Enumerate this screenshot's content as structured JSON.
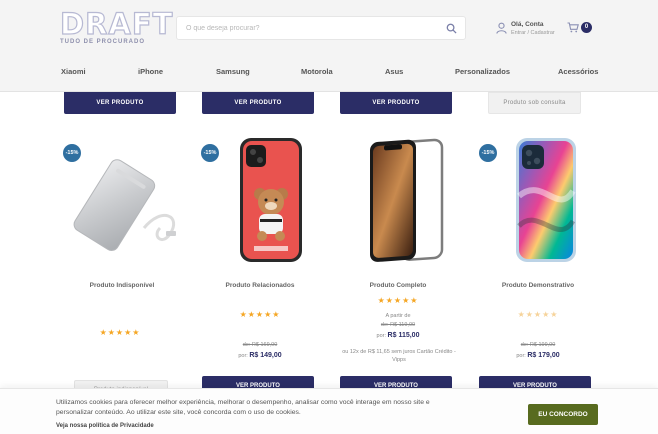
{
  "header": {
    "logo_text": "DRAFT",
    "logo_tagline": "TUDO DE PROCURADO",
    "search_placeholder": "O que deseja procurar?",
    "account_greeting": "Olá, Conta",
    "account_links": "Entrar / Cadastrar",
    "cart_count": "0"
  },
  "nav": {
    "items": [
      "Xiaomi",
      "iPhone",
      "Samsung",
      "Motorola",
      "Asus",
      "Personalizados",
      "Acessórios"
    ]
  },
  "top_row_buttons": [
    "VER PRODUTO",
    "VER PRODUTO",
    "VER PRODUTO",
    "Produto sob consulta"
  ],
  "products": [
    {
      "discount": "-15%",
      "name": "Produto Indisponível",
      "rating": 5,
      "button_label": "Produto indisponível"
    },
    {
      "discount": "-15%",
      "name": "Produto Relacionados",
      "rating": 5,
      "price_old_label": "de: R$ 169,00",
      "price_label_prefix": "por:",
      "price_new": "R$ 149,00",
      "button_label": "VER PRODUTO"
    },
    {
      "name": "Produto Completo",
      "rating": 5,
      "price_from_label": "A partir de",
      "price_old_label": "de: R$ 119,00",
      "price_label_prefix": "por:",
      "price_new": "R$ 115,00",
      "installment_label": "ou 12x de R$ 11,65 sem juros Cartão Crédito - Vipps",
      "button_label": "VER PRODUTO"
    },
    {
      "discount": "-15%",
      "name": "Produto Demonstrativo",
      "rating": 0,
      "price_old_label": "de: R$ 199,00",
      "price_label_prefix": "por:",
      "price_new": "R$ 179,00",
      "button_label": "VER PRODUTO"
    }
  ],
  "cookie": {
    "text": "Utilizamos cookies para oferecer melhor experiência, melhorar o desempenho, analisar como você interage em nosso site e personalizar conteúdo. Ao utilizar este site, você concorda com o uso de cookies.",
    "policy_link": "Veja nossa política de Privacidade",
    "accept_label": "EU CONCORDO"
  },
  "colors": {
    "primary": "#2b2d66",
    "accept": "#586b1f",
    "star": "#f5a623",
    "discount_badge": "#2f6fa0"
  }
}
